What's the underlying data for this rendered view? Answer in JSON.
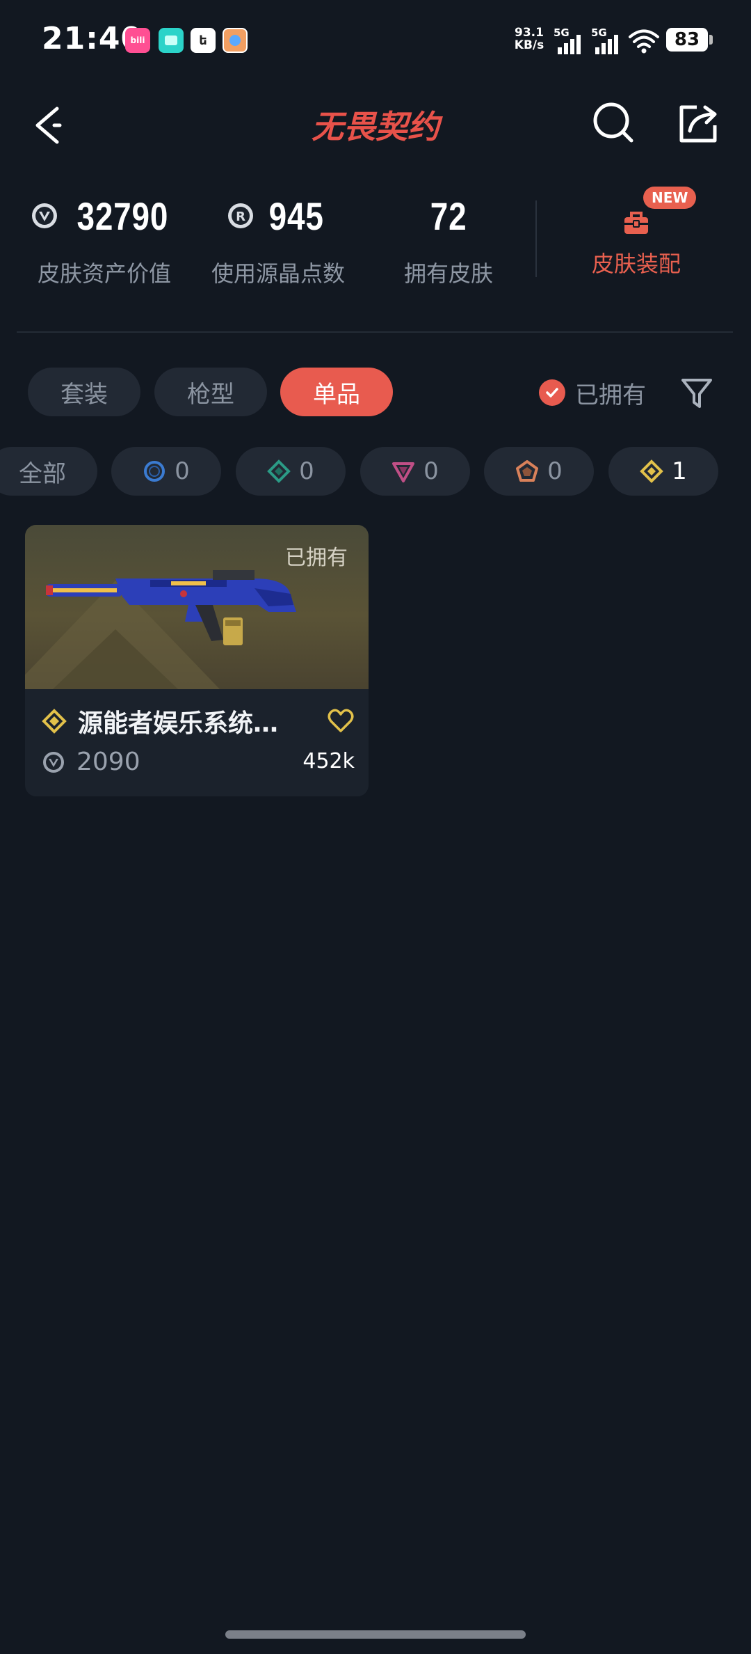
{
  "status_bar": {
    "time": "21:40",
    "net_speed_value": "93.1",
    "net_speed_unit": "KB/s",
    "signal1_label": "5G",
    "signal2_label": "5G",
    "battery": "83",
    "notification_icons": [
      "bilibili-icon",
      "app-icon",
      "sync-app-icon",
      "avatar-app-icon"
    ]
  },
  "header": {
    "title": "无畏契约",
    "brand_color": "#e8524a"
  },
  "stats": {
    "asset_value": "32790",
    "asset_value_label": "皮肤资产价值",
    "crystals_used": "945",
    "crystals_used_label": "使用源晶点数",
    "skins_owned": "72",
    "skins_owned_label": "拥有皮肤",
    "outfit_label": "皮肤装配",
    "new_badge": "NEW"
  },
  "tabs": [
    {
      "label": "套装",
      "selected": false
    },
    {
      "label": "枪型",
      "selected": false
    },
    {
      "label": "单品",
      "selected": true
    }
  ],
  "owned_filter": {
    "label": "已拥有",
    "checked": true
  },
  "rarity_chips": [
    {
      "label": "全部",
      "count": ""
    },
    {
      "icon": "select-tier-icon",
      "count": "0",
      "color": "#3b7bd1"
    },
    {
      "icon": "deluxe-tier-icon",
      "count": "0",
      "color": "#2b9b86"
    },
    {
      "icon": "premium-tier-icon",
      "count": "0",
      "color": "#c04f86"
    },
    {
      "icon": "exclusive-tier-icon",
      "count": "0",
      "color": "#d9815a"
    },
    {
      "icon": "ultra-tier-icon",
      "count": "1",
      "color": "#e2c14a"
    }
  ],
  "items": [
    {
      "name": "源能者娱乐系统…",
      "owned_tag": "已拥有",
      "price": "2090",
      "likes": "452k",
      "rarity_color": "#e2c14a"
    }
  ],
  "accent_color": "#e85b4f"
}
